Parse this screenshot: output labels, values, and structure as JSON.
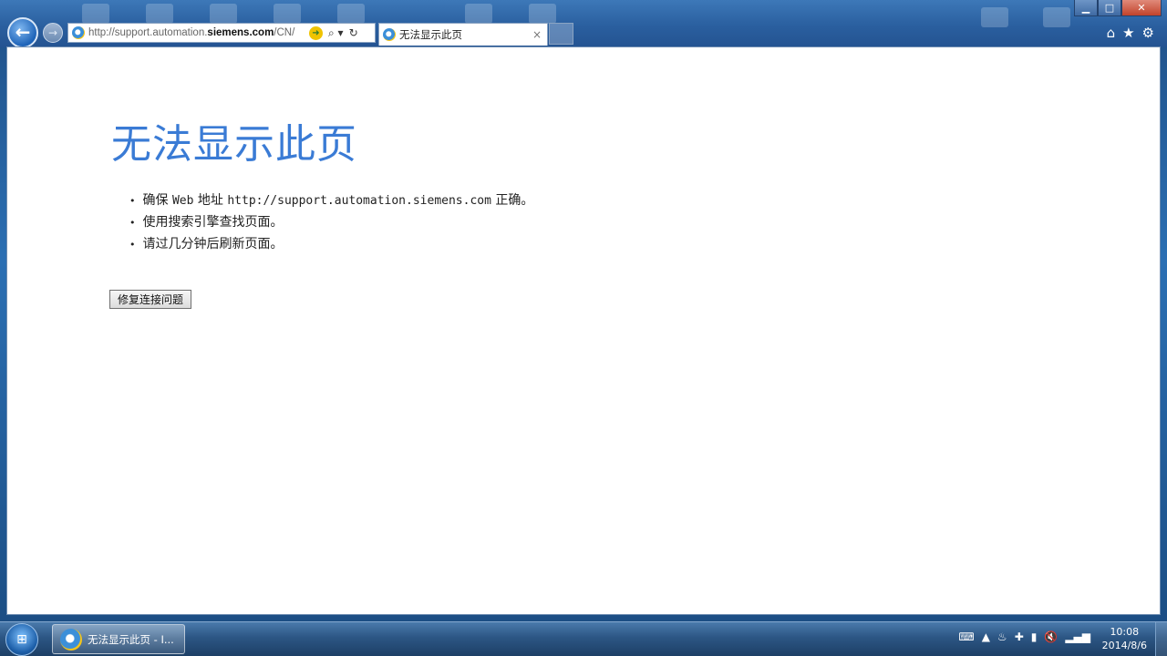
{
  "browser": {
    "address": {
      "url_prefix": "http://support.automation.",
      "url_domain": "siemens.com",
      "url_suffix": "/CN/",
      "search_glyph": "⌕ ▾",
      "refresh_glyph": "↻"
    },
    "tab": {
      "title": "无法显示此页",
      "close_glyph": "×"
    },
    "window_controls": {
      "minimize": "▁",
      "maximize": "□",
      "close": "✕"
    },
    "tools": {
      "home": "⌂",
      "favorites": "★",
      "settings": "⚙"
    }
  },
  "page": {
    "title": "无法显示此页",
    "suggestion_1_pre": "确保 ",
    "suggestion_1_web": "Web",
    "suggestion_1_mid": " 地址 ",
    "suggestion_1_url": "http://support.automation.siemens.com",
    "suggestion_1_post": " 正确。",
    "suggestion_2": "使用搜索引擎查找页面。",
    "suggestion_3": "请过几分钟后刷新页面。",
    "fix_button": "修复连接问题"
  },
  "taskbar": {
    "task_label": "无法显示此页 - I...",
    "clock_time": "10:08",
    "clock_date": "2014/8/6"
  },
  "colors": {
    "title_blue": "#3a7bd5"
  }
}
